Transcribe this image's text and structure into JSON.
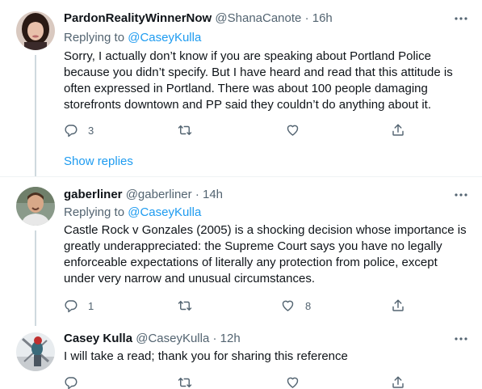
{
  "tweets": [
    {
      "name": "PardonRealityWinnerNow",
      "handle": "@ShanaCanote",
      "time": "16h",
      "replying_label": "Replying to",
      "replying_handle": "@CaseyKulla",
      "lines": [
        "Sorry, I actually don’t know if you are speaking about Portland Police",
        "because you didn’t specify. But I have heard and read that this attitude is",
        "often expressed in Portland. There was about 100 people damaging",
        "storefronts downtown and PP said they couldn’t do anything about it."
      ],
      "reply_count": "3",
      "retweet_count": "",
      "like_count": ""
    },
    {
      "name": "gaberliner",
      "handle": "@gaberliner",
      "time": "14h",
      "replying_label": "Replying to",
      "replying_handle": "@CaseyKulla",
      "lines": [
        "Castle Rock v Gonzales (2005) is a shocking decision whose importance is",
        "greatly underappreciated: the Supreme Court says you have no legally",
        "enforceable expectations of literally any protection from police, except",
        "under very narrow and unusual circumstances."
      ],
      "reply_count": "1",
      "retweet_count": "",
      "like_count": "8"
    },
    {
      "name": "Casey Kulla",
      "handle": "@CaseyKulla",
      "time": "12h",
      "lines": [
        "I will take a read; thank you for sharing this reference"
      ],
      "reply_count": "",
      "retweet_count": "",
      "like_count": ""
    }
  ],
  "show_replies_label": "Show replies",
  "separator": "·",
  "colors": {
    "accent": "#1d9bf0",
    "muted": "#536471",
    "text": "#0f1419",
    "line": "#cfd9de"
  },
  "icons": [
    "more-icon",
    "reply-icon",
    "retweet-icon",
    "like-icon",
    "share-icon"
  ]
}
